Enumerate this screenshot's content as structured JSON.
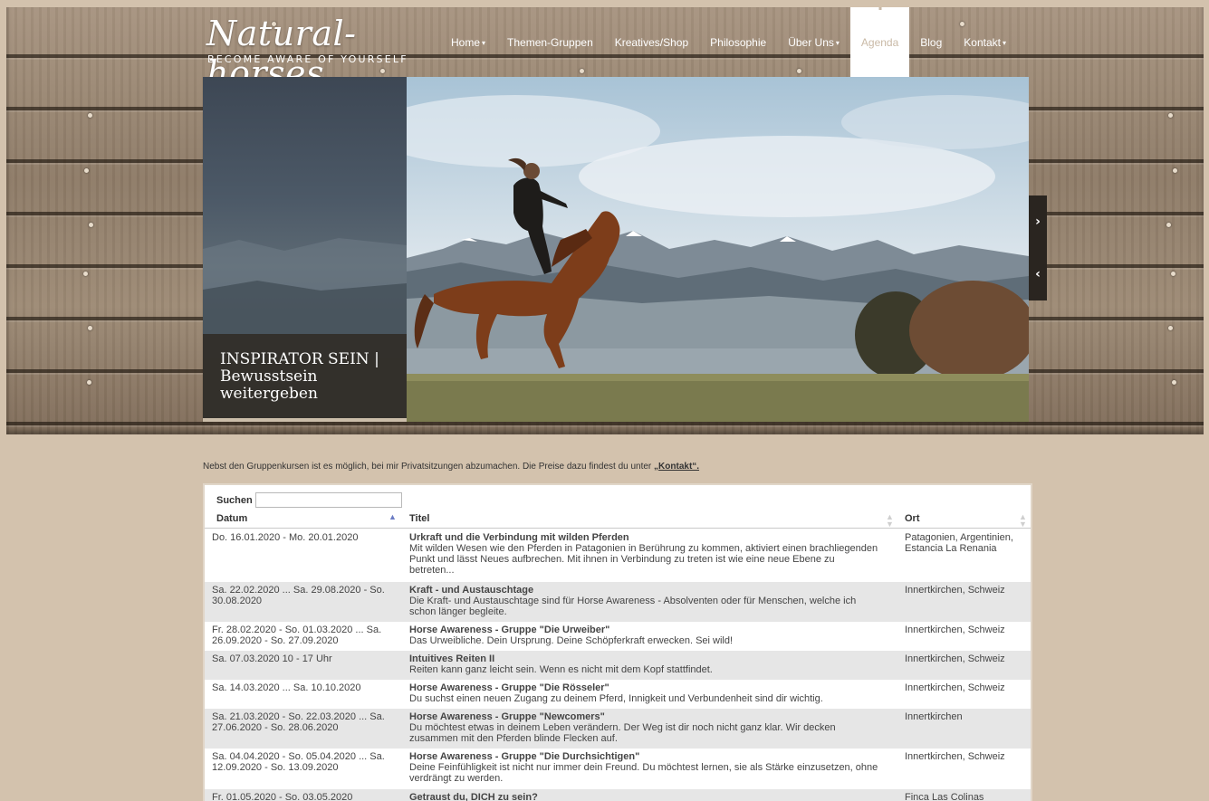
{
  "brand": {
    "name": "Natural-horses",
    "tagline": "BECOME AWARE OF YOURSELF"
  },
  "nav": [
    {
      "label": "Home",
      "dropdown": true,
      "active": false
    },
    {
      "label": "Themen-Gruppen",
      "dropdown": false,
      "active": false
    },
    {
      "label": "Kreatives/Shop",
      "dropdown": false,
      "active": false
    },
    {
      "label": "Philosophie",
      "dropdown": false,
      "active": false
    },
    {
      "label": "Über Uns",
      "dropdown": true,
      "active": false
    },
    {
      "label": "Agenda",
      "dropdown": false,
      "active": true
    },
    {
      "label": "Blog",
      "dropdown": false,
      "active": false
    },
    {
      "label": "Kontakt",
      "dropdown": true,
      "active": false
    }
  ],
  "slider": {
    "caption": "INSPIRATOR SEIN | Bewusstsein weitergeben",
    "next_icon": "chevron-right-icon",
    "prev_icon": "chevron-left-icon"
  },
  "intro": {
    "text_before": "Nebst den Gruppenkursen ist es möglich, bei mir Privatsitzungen abzumachen. Die Preise dazu findest du unter ",
    "link_text": "„Kontakt“.",
    "text_after": ""
  },
  "table": {
    "search_label": "Suchen",
    "search_value": "",
    "columns": [
      "Datum",
      "Titel",
      "Ort"
    ],
    "rows": [
      {
        "date": "Do. 16.01.2020 - Mo. 20.01.2020",
        "title": "Urkraft und die Verbindung mit wilden Pferden",
        "desc": "Mit wilden Wesen wie den Pferden in Patagonien in Berührung zu kommen, aktiviert einen brachliegenden Punkt und lässt Neues aufbrechen. Mit ihnen in Verbindung zu treten ist wie eine neue Ebene zu betreten...",
        "ort": "Patagonien, Argentinien, Estancia La Renania"
      },
      {
        "date": "Sa. 22.02.2020 ... Sa. 29.08.2020 - So. 30.08.2020",
        "title": "Kraft - und Austauschtage",
        "desc": "Die Kraft- und Austauschtage sind für Horse Awareness - Absolventen oder für Menschen, welche ich schon länger begleite.",
        "ort": "Innertkirchen, Schweiz"
      },
      {
        "date": "Fr. 28.02.2020 - So. 01.03.2020 ... Sa. 26.09.2020 - So. 27.09.2020",
        "title": "Horse Awareness - Gruppe \"Die Urweiber\"",
        "desc": "Das Urweibliche. Dein Ursprung. Deine Schöpferkraft erwecken. Sei wild!",
        "ort": "Innertkirchen, Schweiz"
      },
      {
        "date": "Sa. 07.03.2020 10 - 17 Uhr",
        "title": "Intuitives Reiten II",
        "desc": "Reiten kann ganz leicht sein. Wenn es nicht mit dem Kopf stattfindet.",
        "ort": "Innertkirchen, Schweiz"
      },
      {
        "date": "Sa. 14.03.2020 ... Sa. 10.10.2020",
        "title": "Horse Awareness - Gruppe \"Die Rösseler\"",
        "desc": "Du suchst einen neuen Zugang zu deinem Pferd, Innigkeit und Verbundenheit sind dir wichtig.",
        "ort": "Innertkirchen, Schweiz"
      },
      {
        "date": "Sa. 21.03.2020 - So. 22.03.2020 ... Sa. 27.06.2020 - So. 28.06.2020",
        "title": "Horse Awareness - Gruppe \"Newcomers\"",
        "desc": "Du möchtest etwas in deinem Leben verändern. Der Weg ist dir noch nicht ganz klar. Wir decken zusammen mit den Pferden blinde Flecken auf.",
        "ort": "Innertkirchen"
      },
      {
        "date": "Sa. 04.04.2020 - So. 05.04.2020 ... Sa. 12.09.2020 - So. 13.09.2020",
        "title": "Horse Awareness - Gruppe \"Die Durchsichtigen\"",
        "desc": "Deine Feinfühligkeit ist nicht nur immer dein Freund. Du möchtest lernen, sie als Stärke einzusetzen, ohne verdrängt zu werden.",
        "ort": "Innertkirchen, Schweiz"
      },
      {
        "date": "Fr. 01.05.2020 - So. 03.05.2020",
        "title": "Getraust du, DICH zu sein?",
        "desc": "",
        "ort": "Finca Las Colinas"
      }
    ]
  },
  "colors": {
    "page_bg": "#d3c2ad",
    "nav_active_bg": "#ffffff",
    "nav_active_text": "#c9b9a6",
    "row_even": "#e6e6e6"
  }
}
